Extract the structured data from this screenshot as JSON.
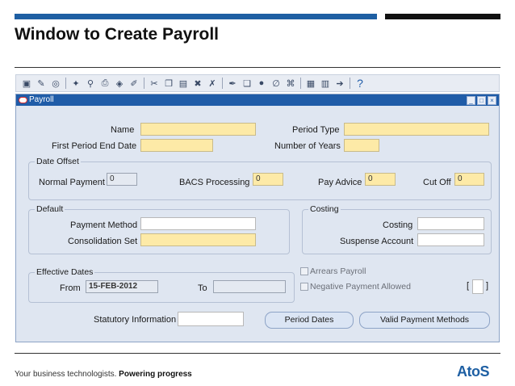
{
  "slide": {
    "title": "Window to Create Payroll"
  },
  "window": {
    "title": "Payroll"
  },
  "form": {
    "name_label": "Name",
    "period_type_label": "Period Type",
    "first_period_end_date_label": "First Period End Date",
    "number_of_years_label": "Number of Years",
    "date_offset": {
      "title": "Date Offset",
      "normal_payment_label": "Normal Payment",
      "normal_payment_value": "0",
      "bacs_label": "BACS Processing",
      "bacs_value": "0",
      "pay_advice_label": "Pay Advice",
      "pay_advice_value": "0",
      "cut_off_label": "Cut Off",
      "cut_off_value": "0"
    },
    "default": {
      "title": "Default",
      "payment_method_label": "Payment Method",
      "consolidation_set_label": "Consolidation Set"
    },
    "costing": {
      "title": "Costing",
      "costing_label": "Costing",
      "suspense_account_label": "Suspense Account"
    },
    "effective_dates": {
      "title": "Effective Dates",
      "from_label": "From",
      "from_value": "15-FEB-2012",
      "to_label": "To"
    },
    "arrears_payroll_label": "Arrears Payroll",
    "negative_payment_label": "Negative Payment Allowed",
    "statutory_information_label": "Statutory Information",
    "buttons": {
      "period_dates": "Period Dates",
      "valid_payment_methods": "Valid Payment Methods"
    }
  },
  "footer": {
    "tagline_plain": "Your business technologists.",
    "tagline_bold": "Powering progress",
    "logo": "AtoS"
  }
}
